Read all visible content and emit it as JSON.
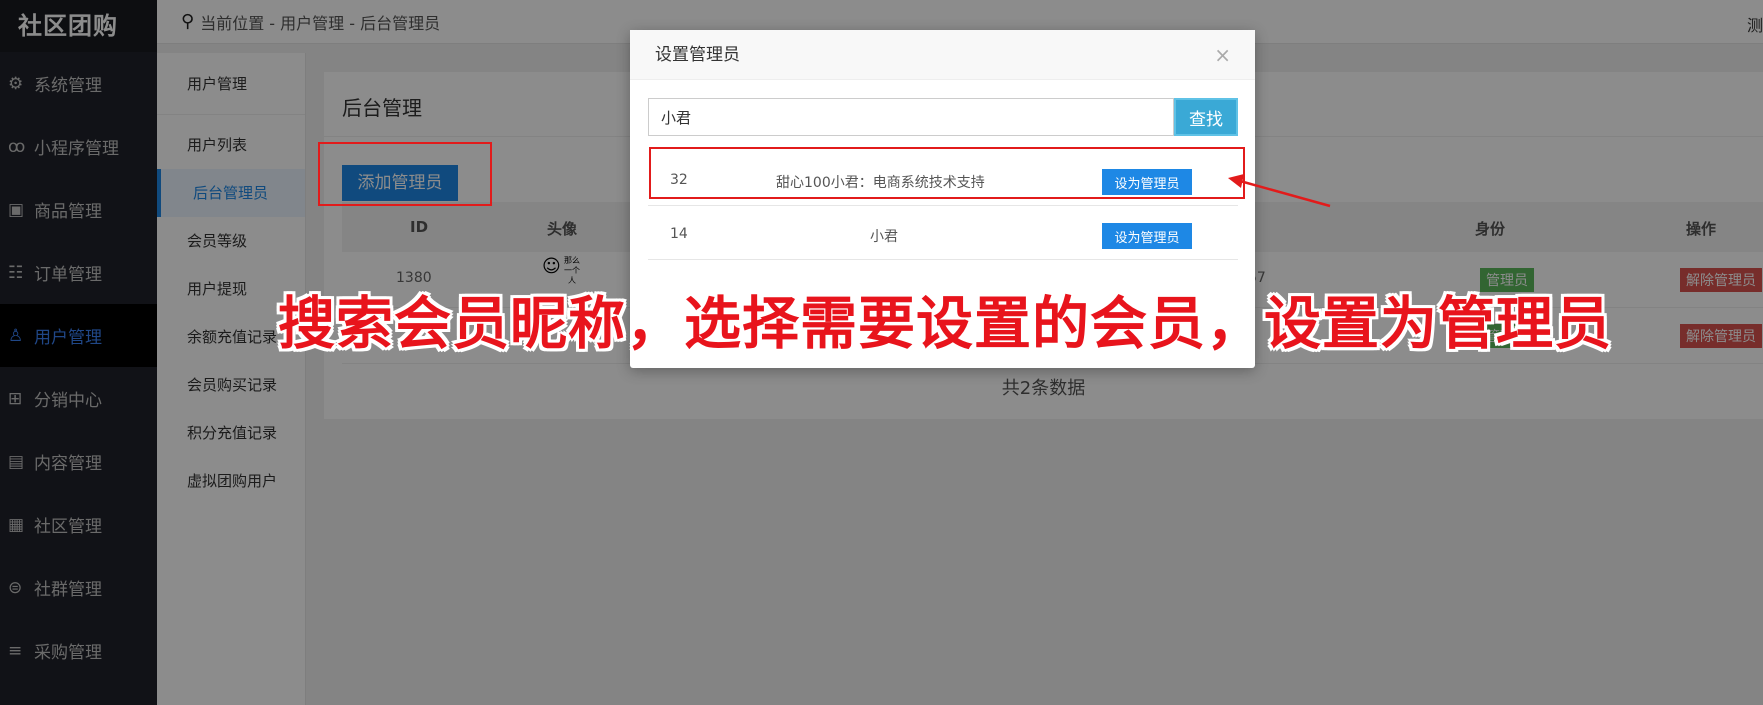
{
  "sidebar": {
    "logo": "社区团购",
    "items": [
      {
        "label": "系统管理",
        "icon": "gear-icon"
      },
      {
        "label": "小程序管理",
        "icon": "miniprogram-icon"
      },
      {
        "label": "商品管理",
        "icon": "bag-icon"
      },
      {
        "label": "订单管理",
        "icon": "clipboard-icon"
      },
      {
        "label": "用户管理",
        "icon": "user-icon"
      },
      {
        "label": "分销中心",
        "icon": "sitemap-icon"
      },
      {
        "label": "内容管理",
        "icon": "content-icon"
      },
      {
        "label": "社区管理",
        "icon": "store-icon"
      },
      {
        "label": "社群管理",
        "icon": "group-icon"
      },
      {
        "label": "采购管理",
        "icon": "list-add-icon"
      }
    ]
  },
  "topbar": {
    "breadcrumb": "当前位置 - 用户管理 - 后台管理员",
    "right_cut": "测"
  },
  "submenu": {
    "header": "用户管理",
    "items": [
      "用户列表",
      "后台管理员",
      "会员等级",
      "用户提现",
      "余额充值记录",
      "会员购买记录",
      "积分充值记录",
      "虚拟团购用户"
    ]
  },
  "main": {
    "title": "后台管理",
    "add_button": "添加管理员",
    "columns": [
      "ID",
      "头像",
      "身份",
      "操作"
    ],
    "rows": [
      {
        "id": "1380",
        "avatar_text": "那么一个人",
        "tail": "57",
        "role": "管理员",
        "action": "解除管理员"
      },
      {
        "id": "",
        "avatar_text": "",
        "tail": "",
        "role": "管理员",
        "action": "解除管理员"
      }
    ],
    "total": "共2条数据"
  },
  "modal": {
    "title": "设置管理员",
    "close": "×",
    "search_value": "小君",
    "search_button": "查找",
    "results": [
      {
        "id": "32",
        "name": "甜心100小君：电商系统技术支持",
        "button": "设为管理员"
      },
      {
        "id": "14",
        "name": "小君",
        "button": "设为管理员"
      }
    ]
  },
  "annotation": {
    "caption": "搜索会员昵称，选择需要设置的会员，设置为管理员",
    "color": "#e21b1b"
  }
}
